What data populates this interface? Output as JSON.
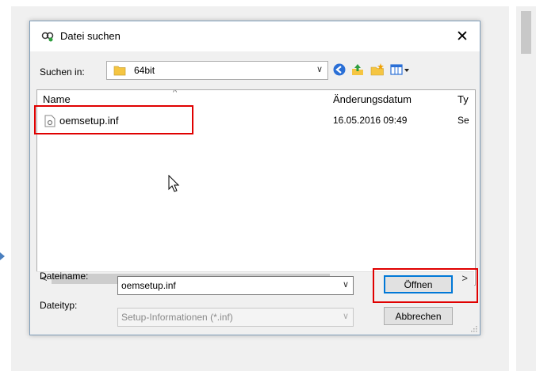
{
  "dialog": {
    "title": "Datei suchen",
    "close_label": "✕"
  },
  "lookin": {
    "label": "Suchen in:",
    "value": "64bit"
  },
  "columns": {
    "name": "Name",
    "date": "Änderungsdatum",
    "type": "Ty"
  },
  "files": [
    {
      "name": "oemsetup.inf",
      "date": "16.05.2016 09:49",
      "type": "Se"
    }
  ],
  "filename": {
    "label": "Dateiname:",
    "value": "oemsetup.inf"
  },
  "filetype": {
    "label": "Dateityp:",
    "value": "Setup-Informationen (*.inf)"
  },
  "buttons": {
    "open": "Öffnen",
    "cancel": "Abbrechen"
  },
  "icons": {
    "title": "find-file-icon",
    "back": "back-icon",
    "up": "up-folder-icon",
    "new_folder": "new-folder-icon",
    "view_menu": "view-menu-icon"
  },
  "colors": {
    "highlight": "#e00000",
    "accent": "#0078d7"
  }
}
